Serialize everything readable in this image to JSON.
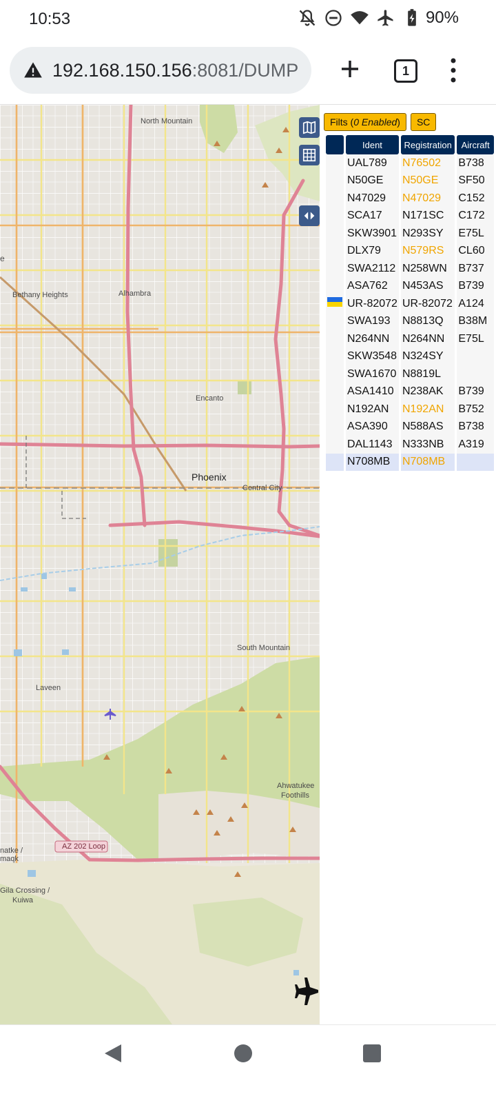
{
  "status": {
    "time": "10:53",
    "battery": "90%",
    "icons": [
      "mute-icon",
      "dnd-icon",
      "wifi-icon",
      "airplane-icon",
      "battery-icon"
    ]
  },
  "browser": {
    "url_host": "192.168.150.156",
    "url_rest": ":8081/DUMP",
    "tab_count": "1"
  },
  "map": {
    "labels": {
      "north_mountain": "North Mountain",
      "bethany_heights": "Bethany Heights",
      "alhambra": "Alhambra",
      "encanto": "Encanto",
      "phoenix": "Phoenix",
      "central_city": "Central City",
      "south_mountain": "South Mountain",
      "laveen": "Laveen",
      "ahwatukee": "Ahwatukee",
      "foothills": "Foothills",
      "az202": "AZ 202 Loop",
      "gila_crossing": "Gila Crossing /",
      "kuiwa": "Kuiwa",
      "natke": "natke /",
      "maqk": "maqk",
      "edge_e": "e"
    }
  },
  "panel": {
    "filters_prefix": "Filts (",
    "filters_enabled": "0 Enabled",
    "filters_suffix": ")",
    "sc_label": "SC",
    "headers": {
      "flag": "",
      "ident": "Ident",
      "registration": "Registration",
      "aircraft": "Aircraft"
    },
    "rows": [
      {
        "ident": "UAL789",
        "registration": "N76502",
        "type": "B738",
        "highlight": true
      },
      {
        "ident": "N50GE",
        "registration": "N50GE",
        "type": "SF50",
        "highlight": true
      },
      {
        "ident": "N47029",
        "registration": "N47029",
        "type": "C152",
        "highlight": true
      },
      {
        "ident": "SCA17",
        "registration": "N171SC",
        "type": "C172",
        "highlight": false
      },
      {
        "ident": "SKW3901",
        "registration": "N293SY",
        "type": "E75L",
        "highlight": false
      },
      {
        "ident": "DLX79",
        "registration": "N579RS",
        "type": "CL60",
        "highlight": true
      },
      {
        "ident": "SWA2112",
        "registration": "N258WN",
        "type": "B737",
        "highlight": false
      },
      {
        "ident": "ASA762",
        "registration": "N453AS",
        "type": "B739",
        "highlight": false
      },
      {
        "ident": "UR-82072",
        "registration": "UR-82072",
        "type": "A124",
        "highlight": false,
        "flag": "ukraine"
      },
      {
        "ident": "SWA193",
        "registration": "N8813Q",
        "type": "B38M",
        "highlight": false
      },
      {
        "ident": "N264NN",
        "registration": "N264NN",
        "type": "E75L",
        "highlight": false
      },
      {
        "ident": "SKW3548",
        "registration": "N324SY",
        "type": "",
        "highlight": false
      },
      {
        "ident": "SWA1670",
        "registration": "N8819L",
        "type": "",
        "highlight": false
      },
      {
        "ident": "ASA1410",
        "registration": "N238AK",
        "type": "B739",
        "highlight": false
      },
      {
        "ident": "N192AN",
        "registration": "N192AN",
        "type": "B752",
        "highlight": true
      },
      {
        "ident": "ASA390",
        "registration": "N588AS",
        "type": "B738",
        "highlight": false
      },
      {
        "ident": "DAL1143",
        "registration": "N333NB",
        "type": "A319",
        "highlight": false
      },
      {
        "ident": "N708MB",
        "registration": "N708MB",
        "type": "",
        "highlight": true,
        "selected": true
      }
    ]
  },
  "colors": {
    "header_bg": "#002856",
    "button_yellow": "#f8b900",
    "registration_highlight": "#f0a500",
    "selected_row": "#dde4f7",
    "map_bg": "#f2efe9",
    "park_green": "#cddca5",
    "road_yellow": "#f7f0a0",
    "highway_pink": "#e08b9a"
  }
}
